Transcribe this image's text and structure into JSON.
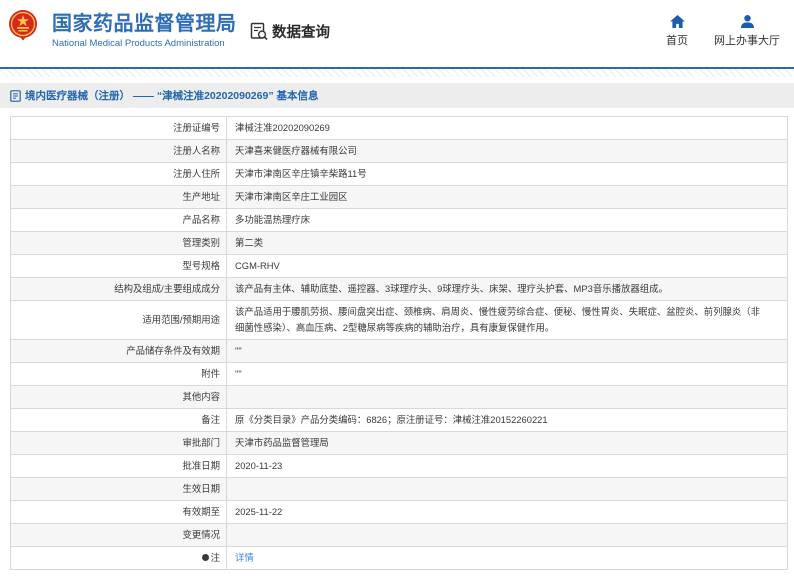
{
  "header": {
    "title_cn": "国家药品监督管理局",
    "title_en": "National Medical Products Administration",
    "section_label": "数据查询",
    "nav": [
      {
        "label": "首页",
        "icon": "home-icon"
      },
      {
        "label": "网上办事大厅",
        "icon": "person-icon"
      }
    ],
    "accent_blue": "#2f6eb4",
    "emblem_red": "#d6281e",
    "emblem_gold": "#f7c948"
  },
  "breadcrumb": {
    "text": "境内医疗器械（注册） ——  “津械注准20202090269” 基本信息"
  },
  "table": {
    "rows": [
      {
        "label": "注册证编号",
        "value": "津械注准20202090269"
      },
      {
        "label": "注册人名称",
        "value": "天津喜来健医疗器械有限公司"
      },
      {
        "label": "注册人住所",
        "value": "天津市津南区辛庄镇辛柴路11号"
      },
      {
        "label": "生产地址",
        "value": "天津市津南区辛庄工业园区"
      },
      {
        "label": "产品名称",
        "value": "多功能温热理疗床"
      },
      {
        "label": "管理类别",
        "value": "第二类"
      },
      {
        "label": "型号规格",
        "value": "CGM-RHV"
      },
      {
        "label": "结构及组成/主要组成成分",
        "value": "该产品有主体、辅助底垫、遥控器、3球理疗头、9球理疗头、床架、理疗头护套、MP3音乐播放器组成。"
      },
      {
        "label": "适用范围/预期用途",
        "value": "该产品适用于腰肌劳损、腰间盘突出症、颈椎病、肩周炎、慢性疲劳综合症、便秘、慢性胃炎、失眠症、盆腔炎、前列腺炎（非细菌性感染）、高血压病、2型糖尿病等疾病的辅助治疗，具有康复保健作用。"
      },
      {
        "label": "产品储存条件及有效期",
        "value": "\"\""
      },
      {
        "label": "附件",
        "value": "\"\""
      },
      {
        "label": "其他内容",
        "value": ""
      },
      {
        "label": "备注",
        "value": "原《分类目录》产品分类编码：6826；原注册证号：津械注准20152260221"
      },
      {
        "label": "审批部门",
        "value": "天津市药品监督管理局"
      },
      {
        "label": "批准日期",
        "value": "2020-11-23"
      },
      {
        "label": "生效日期",
        "value": ""
      },
      {
        "label": "有效期至",
        "value": "2025-11-22"
      },
      {
        "label": "变更情况",
        "value": ""
      },
      {
        "label": "注",
        "value": "详情",
        "link": true,
        "label_icon": "bulb-icon"
      }
    ]
  }
}
